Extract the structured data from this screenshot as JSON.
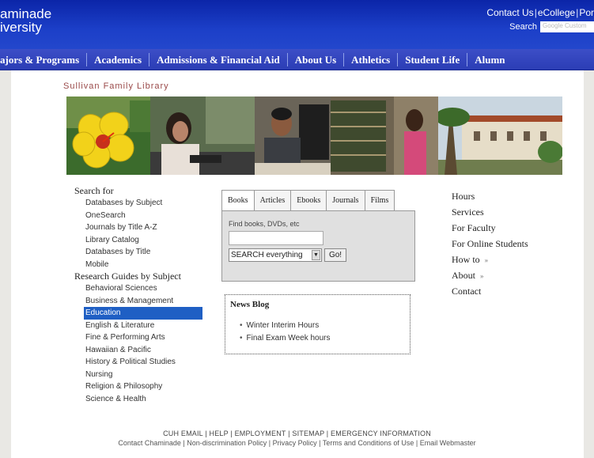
{
  "header": {
    "logo_line1": "aminade",
    "logo_line2": "iversity",
    "top_links": [
      "Contact Us",
      "eCollege",
      "Por"
    ],
    "search_label": "Search",
    "search_placeholder": "Google Custom"
  },
  "nav": [
    "ajors & Programs",
    "Academics",
    "Admissions & Financial Aid",
    "About Us",
    "Athletics",
    "Student Life",
    "Alumn"
  ],
  "library_title": "Sullivan Family Library",
  "left": {
    "search_heading": "Search for",
    "search_items": [
      "Databases by Subject",
      "OneSearch",
      "Journals by Title A-Z",
      "Library Catalog",
      "Databases by Title",
      "Mobile"
    ],
    "guides_heading": "Research Guides by Subject",
    "guide_items": [
      "Behavioral Sciences",
      "Business & Management",
      "Education",
      "English & Literature",
      "Fine & Performing Arts",
      "Hawaiian & Pacific",
      "History & Political Studies",
      "Nursing",
      "Religion & Philosophy",
      "Science & Health"
    ]
  },
  "tabs": [
    "Books",
    "Articles",
    "Ebooks",
    "Journals",
    "Films"
  ],
  "search_box": {
    "find_label": "Find books, DVDs, etc",
    "scope_value": "SEARCH everything",
    "go_label": "Go!"
  },
  "news": {
    "title": "News Blog",
    "items": [
      "Winter Interim Hours",
      "Final Exam Week hours"
    ]
  },
  "right": {
    "items": [
      "Hours",
      "Services",
      "For Faculty",
      "For Online Students",
      "How to",
      "About",
      "Contact"
    ],
    "chevron": "»"
  },
  "footer": {
    "line1": "CUH EMAIL | HELP | EMPLOYMENT | SITEMAP | EMERGENCY INFORMATION",
    "line2": "Contact Chaminade | Non-discrimination Policy | Privacy Policy | Terms and Conditions of Use | Email Webmaster"
  },
  "colors": {
    "header_blue": "#1c3fc8",
    "nav_blue": "#2b3db5",
    "active_guide": "#1f5fc4"
  }
}
